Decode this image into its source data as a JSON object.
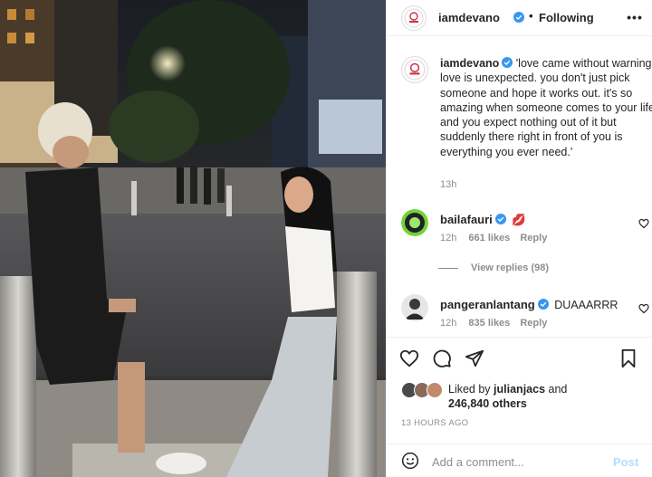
{
  "post": {
    "username": "iamdevano",
    "follow_status": "Following",
    "more_label": "•••",
    "caption": "'love came without warning. love is unexpected. you don't just pick someone and hope it works out. it's so amazing when someone comes to your life and you expect nothing out of it but suddenly there right in front of you is everything you ever need.'",
    "caption_time": "13h"
  },
  "comments": [
    {
      "username": "bailafauri",
      "text": "💋",
      "time": "12h",
      "likes": "661 likes",
      "reply_label": "Reply",
      "view_replies": "View replies (98)"
    },
    {
      "username": "pangeranlantang",
      "text": "DUAAARRR",
      "time": "12h",
      "likes": "835 likes",
      "reply_label": "Reply"
    }
  ],
  "likes": {
    "prefix": "Liked by",
    "user": "julianjacs",
    "joiner": "and",
    "others": "246,840 others"
  },
  "timestamp": "13 HOURS AGO",
  "add_comment": {
    "placeholder": "Add a comment...",
    "post_label": "Post"
  },
  "colors": {
    "verified": "#3897f0",
    "post_button": "#b2dffc",
    "muted_text": "#8e8e8e"
  }
}
